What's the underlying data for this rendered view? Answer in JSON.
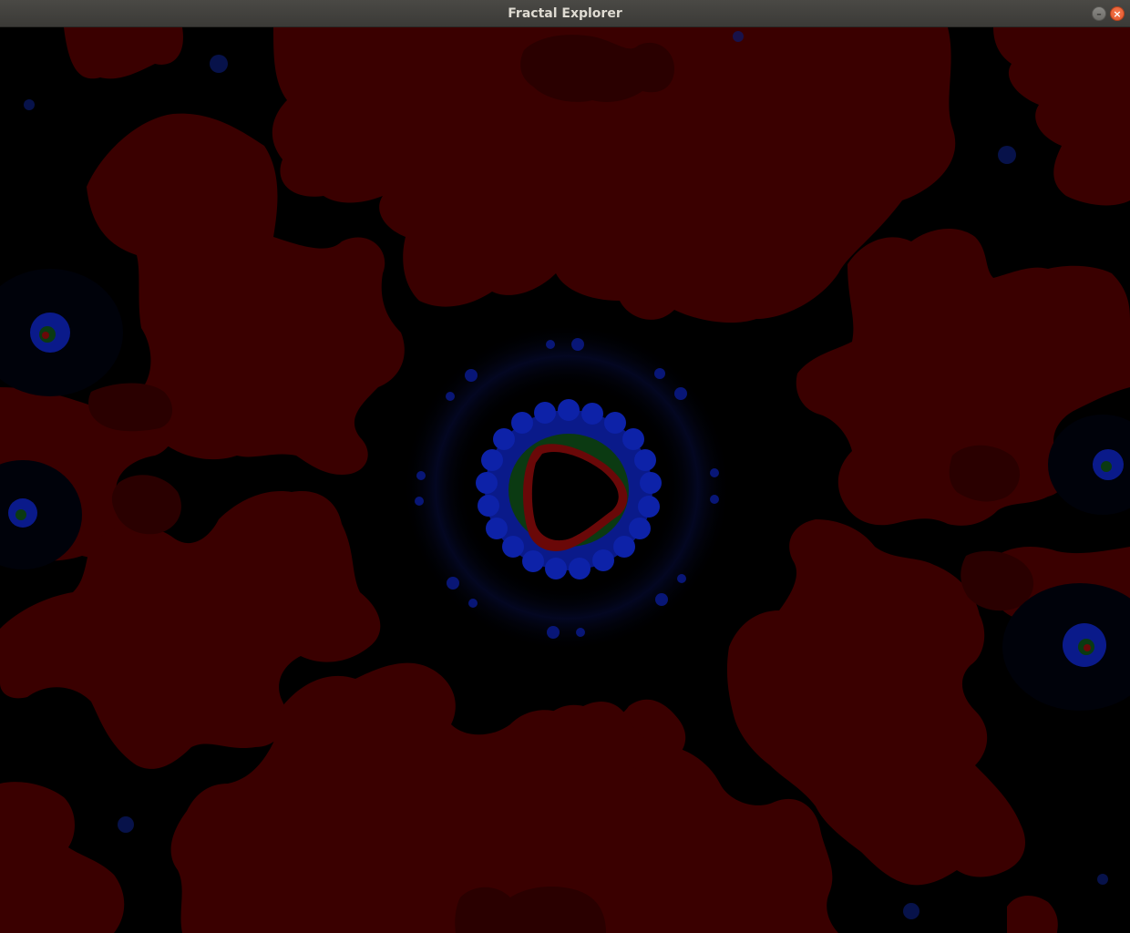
{
  "window": {
    "title": "Fractal Explorer",
    "minimize_glyph": "–",
    "close_glyph": "×"
  },
  "icons": {
    "minimize": "minimize-icon",
    "close": "close-icon"
  },
  "colors": {
    "lobe_fill": "#3a0000",
    "lobe_edge": "#4a0303",
    "background": "#000000",
    "halo_blue": "#0a1a8a",
    "ring_green": "#0b3a12",
    "ring_red": "#6a0808",
    "titlebar": "#3b3a37",
    "close_button": "#e0542a"
  }
}
